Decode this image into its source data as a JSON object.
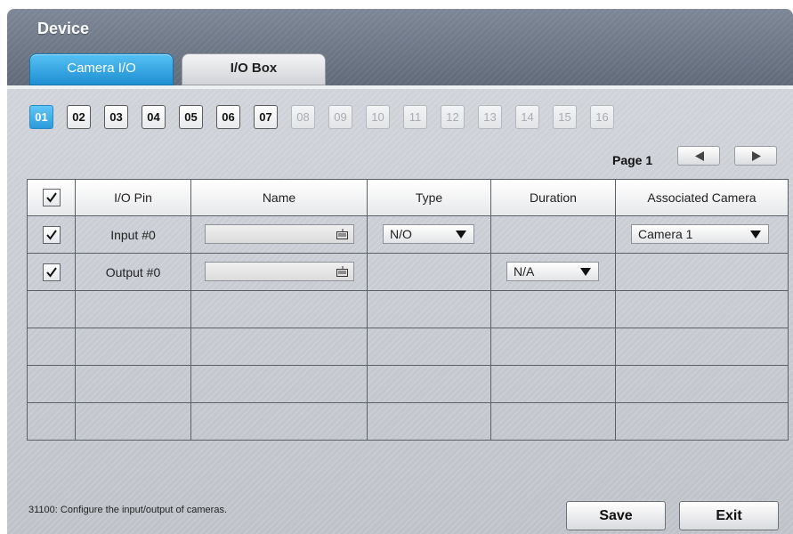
{
  "window": {
    "title": "Device"
  },
  "tabs": [
    {
      "label": "Camera I/O",
      "active": true
    },
    {
      "label": "I/O Box",
      "active": false
    }
  ],
  "channels": [
    "01",
    "02",
    "03",
    "04",
    "05",
    "06",
    "07",
    "08",
    "09",
    "10",
    "11",
    "12",
    "13",
    "14",
    "15",
    "16"
  ],
  "channel_state": {
    "selected": "01",
    "disabled": [
      "08",
      "09",
      "10",
      "11",
      "12",
      "13",
      "14",
      "15",
      "16"
    ]
  },
  "pager": {
    "label": "Page 1"
  },
  "table": {
    "columns": [
      "I/O Pin",
      "Name",
      "Type",
      "Duration",
      "Associated Camera"
    ],
    "header_checked": true,
    "rows": [
      {
        "pin": "Input #0",
        "name": "",
        "type": "N/O",
        "duration": "",
        "camera": "Camera 1",
        "checked": true
      },
      {
        "pin": "Output #0",
        "name": "",
        "type": "",
        "duration": "N/A",
        "camera": "",
        "checked": true
      }
    ],
    "empty_row_count": 4
  },
  "footer": {
    "hint": "31100: Configure the input/output of cameras.",
    "save_label": "Save",
    "exit_label": "Exit"
  },
  "icons": [
    "checkmark-icon",
    "keyboard-icon",
    "dropdown-arrow-icon",
    "arrow-left-icon",
    "arrow-right-icon"
  ],
  "colors": {
    "accent": "#1e8fd2",
    "titlebar": "#6a7483",
    "background": "#c9ccd1"
  }
}
